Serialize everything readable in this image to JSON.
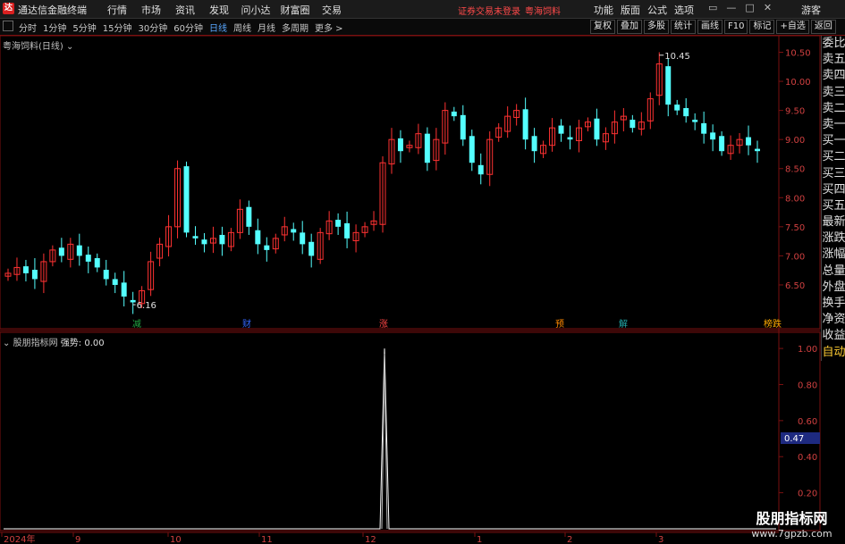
{
  "app": {
    "logo_text": "达",
    "title": "通达信金融终端"
  },
  "main_menu": [
    "行情",
    "市场",
    "资讯",
    "发现",
    "问小达",
    "财富圈",
    "交易"
  ],
  "notice": {
    "text": "证券交易未登录",
    "stock": "粤海饲料"
  },
  "right_menu": [
    "功能",
    "版面",
    "公式",
    "选项"
  ],
  "window_controls": [
    "▭",
    "—",
    "□",
    "✕"
  ],
  "guest": "游客",
  "periods": [
    "分时",
    "1分钟",
    "5分钟",
    "15分钟",
    "30分钟",
    "60分钟",
    "日线",
    "周线",
    "月线",
    "多周期",
    "更多 >"
  ],
  "active_period": "日线",
  "tools": [
    "复权",
    "叠加",
    "多股",
    "统计",
    "画线",
    "F10",
    "标记",
    "+自选",
    "返回"
  ],
  "main_chart": {
    "title": "粤海饲料(日线)",
    "y_ticks": [
      "10.50",
      "10.00",
      "9.50",
      "9.00",
      "8.50",
      "8.00",
      "7.50",
      "7.00",
      "6.50"
    ],
    "high_label": "10.45",
    "low_label": "6.16",
    "up_color": "#ff3232",
    "down_color": "#54ffff",
    "event_markers": [
      {
        "text": "减",
        "color": "#22aa44"
      },
      {
        "text": "财",
        "color": "#3366ff"
      },
      {
        "text": "涨",
        "color": "#ff4444"
      },
      {
        "text": "预",
        "color": "#ff8800"
      },
      {
        "text": "解",
        "color": "#22aaaa"
      },
      {
        "text": "榜跌",
        "color": "#ffaa00"
      }
    ]
  },
  "sidebar": [
    "委比",
    "卖五",
    "卖四",
    "卖三",
    "卖二",
    "卖一",
    "买一",
    "买二",
    "买三",
    "买四",
    "买五",
    "最新",
    "涨跌",
    "涨幅",
    "总量",
    "外盘",
    "换手",
    "净资",
    "收益",
    "自动"
  ],
  "indicator": {
    "name": "股朋指标网",
    "label": "强势:",
    "value": "0.00",
    "y_ticks": [
      "1.00",
      "0.80",
      "0.60",
      "0.40",
      "0.20"
    ],
    "current_value": "0.47"
  },
  "x_labels": [
    "2024年",
    "9",
    "10",
    "11",
    "12",
    "1",
    "2",
    "3"
  ],
  "watermark": {
    "line1": "股朋指标网",
    "line2": "www.7gpzb.com"
  },
  "chart_data": [
    {
      "type": "candlestick",
      "title": "粤海饲料(日线)",
      "ylim": [
        6.1,
        10.6
      ],
      "high": 10.45,
      "low": 6.16,
      "close_approx": [
        6.7,
        6.8,
        6.7,
        6.6,
        6.9,
        7.1,
        7.0,
        7.2,
        7.0,
        6.9,
        6.8,
        6.6,
        6.5,
        6.3,
        6.2,
        6.4,
        6.9,
        7.2,
        7.5,
        8.5,
        7.4,
        7.3,
        7.2,
        7.3,
        7.2,
        7.4,
        7.8,
        7.5,
        7.2,
        7.1,
        7.3,
        7.5,
        7.4,
        7.2,
        7.0,
        7.4,
        7.6,
        7.5,
        7.3,
        7.4,
        7.5,
        7.6,
        8.6,
        9.0,
        8.8,
        8.9,
        9.1,
        8.6,
        9.0,
        9.5,
        9.4,
        9.0,
        8.6,
        8.4,
        9.0,
        9.2,
        9.4,
        9.5,
        9.0,
        8.8,
        8.9,
        9.2,
        9.1,
        9.0,
        9.2,
        9.3,
        9.0,
        9.1,
        9.3,
        9.4,
        9.2,
        9.3,
        9.7,
        10.3,
        9.6,
        9.5,
        9.4,
        9.3,
        9.1,
        9.0,
        8.8,
        8.9,
        9.0,
        8.9,
        8.8
      ]
    },
    {
      "type": "line",
      "title": "强势",
      "ylim": [
        0,
        1.05
      ],
      "peak_value": 1.0,
      "baseline_value": 0.0
    }
  ]
}
